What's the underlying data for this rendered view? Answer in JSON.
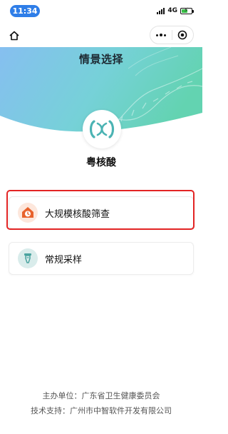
{
  "status_bar": {
    "time": "11:34",
    "network": "4G"
  },
  "header": {
    "title": "情景选择"
  },
  "app": {
    "name": "粤核酸"
  },
  "options": [
    {
      "label": "大规模核酸筛查",
      "icon": "house-clock-icon",
      "highlighted": true
    },
    {
      "label": "常规采样",
      "icon": "test-tube-icon",
      "highlighted": false
    }
  ],
  "footer": {
    "organizer": "主办单位：广东省卫生健康委员会",
    "tech_support": "技术支持：广州市中智软件开发有限公司"
  },
  "colors": {
    "time_pill": "#2f7ee8",
    "highlight_border": "#e32424",
    "brand_teal": "#4bb3b3",
    "orange_icon": "#e8622c"
  }
}
